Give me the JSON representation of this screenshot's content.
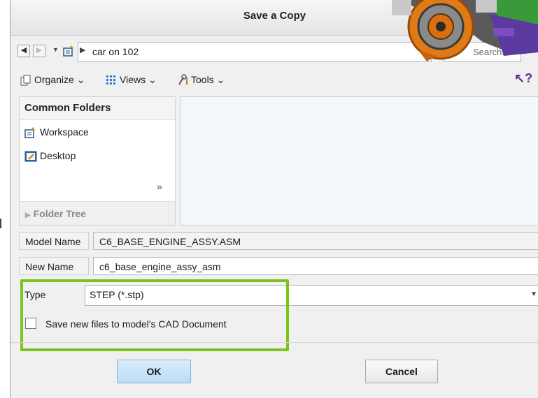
{
  "window": {
    "title": "Save a Copy"
  },
  "address_bar": {
    "path": "car on 102"
  },
  "search": {
    "placeholder": "Search..."
  },
  "toolbar": {
    "organize": "Organize",
    "views": "Views",
    "tools": "Tools"
  },
  "left_pane": {
    "header": "Common Folders",
    "items": [
      {
        "label": "Workspace",
        "icon": "workspace-icon"
      },
      {
        "label": "Desktop",
        "icon": "desktop-icon"
      }
    ],
    "folder_tree": "Folder Tree"
  },
  "form": {
    "model_name_label": "Model Name",
    "model_name_value": "C6_BASE_ENGINE_ASSY.ASM",
    "new_name_label": "New Name",
    "new_name_value": "c6_base_engine_assy_asm",
    "type_label": "Type",
    "type_value": "STEP (*.stp)",
    "checkbox_label": "Save new files to model's CAD Document",
    "checkbox_checked": false
  },
  "buttons": {
    "ok": "OK",
    "cancel": "Cancel"
  },
  "colors": {
    "highlight": "#7dc21e",
    "ok_button": "#bcdcf5",
    "file_pane": "#f1f7fb"
  }
}
